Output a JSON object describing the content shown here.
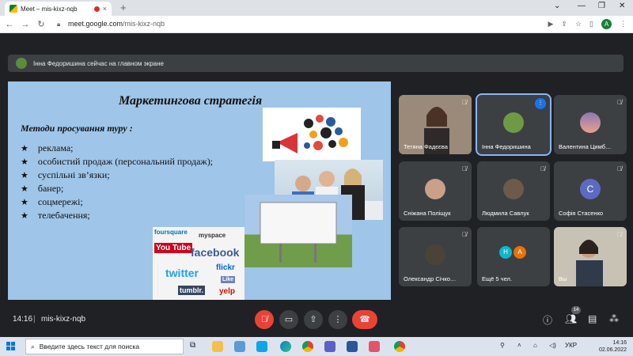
{
  "browser": {
    "tab_title": "Meet – mis-kixz-nqb",
    "tab_close": "×",
    "new_tab": "+",
    "url_host": "meet.google.com",
    "url_path": "/mis-kixz-nqb",
    "profile_letter": "A",
    "window_min": "⌄",
    "window_min2": "—",
    "window_restore": "❐",
    "window_close": "✕"
  },
  "banner": {
    "text": "Інна Федоришина сейчас на главном экране"
  },
  "slide": {
    "title": "Маркетингова стратегія",
    "subtitle": "Методи просування туру :",
    "bullet_glyph": "★",
    "items": [
      "реклама;",
      "особистий продаж (персональний продаж);",
      "суспільні зв’язки;",
      "банер;",
      "соцмережі;",
      "телебачення;"
    ],
    "logos": [
      "You Tube",
      "facebook",
      "twitter",
      "flickr",
      "tumblr.",
      "yelp",
      "foursquare",
      "Like",
      "myspace"
    ]
  },
  "participants": [
    {
      "name": "Тетяна Фадєєва",
      "mic": "muted"
    },
    {
      "name": "Інна Федоришина",
      "mic": "speaking"
    },
    {
      "name": "Валентина Цимб…",
      "mic": "muted"
    },
    {
      "name": "Сніжана Поліщук",
      "mic": "muted"
    },
    {
      "name": "Людмила Савлук",
      "mic": "muted"
    },
    {
      "name": "Софія Стасенко",
      "mic": "muted",
      "initial": "С"
    },
    {
      "name": "Олександр Січко…",
      "mic": "muted"
    },
    {
      "name": "Ещё 5 чел.",
      "initials": [
        "Н",
        "А"
      ]
    },
    {
      "name": "Вы",
      "mic": "muted"
    }
  ],
  "controls": {
    "time": "14:16",
    "separator": "|",
    "meeting_code": "mis-kixz-nqb",
    "participants_count": "14"
  },
  "taskbar": {
    "search_placeholder": "Введите здесь текст для поиска",
    "lang": "УКР",
    "clock_time": "14:16",
    "clock_date": "02.06.2022"
  },
  "colors": {
    "slide_bg": "#9fc5e8",
    "meet_bg": "#202124",
    "tile_bg": "#3c4043",
    "red": "#ea4335",
    "accent": "#8ab4f8"
  }
}
